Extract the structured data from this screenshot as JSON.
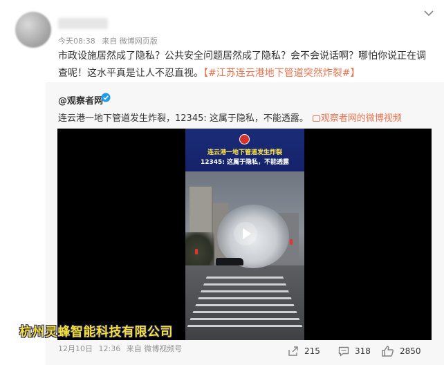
{
  "post": {
    "time": "今天08:38",
    "source": "来自 微博网页版",
    "text_line1": "市政设施居然成了隐私？公共安全问题居然成了隐私？会不会说话啊？哪怕你说正在调",
    "text_line2": "查呢！这水平真是让人不忍直视。",
    "hashtag": "【#江苏连云港地下管道突然炸裂#】"
  },
  "repost": {
    "username": "@观察者网",
    "text": "连云港一地下管道发生炸裂，12345: 这属于隐私，不能透露。",
    "video_link": "观察者网的微博视频"
  },
  "video": {
    "caption1": "连云港一地下管道发生炸裂",
    "caption2": "12345: 这属于隐私，不能透露",
    "watermark": "杭州灵蜂智能科技有限公司"
  },
  "video_meta": {
    "date": "12月10日",
    "time": "12:36",
    "source": "来自 微博视频号"
  },
  "actions": {
    "share_count": "215",
    "comment_count": "318",
    "like_count": "2850"
  },
  "colors": {
    "link_orange": "#eb7350",
    "meta_gray": "#939393",
    "repost_bg": "#f7f7f7",
    "verify_blue": "#1e9cf0"
  }
}
